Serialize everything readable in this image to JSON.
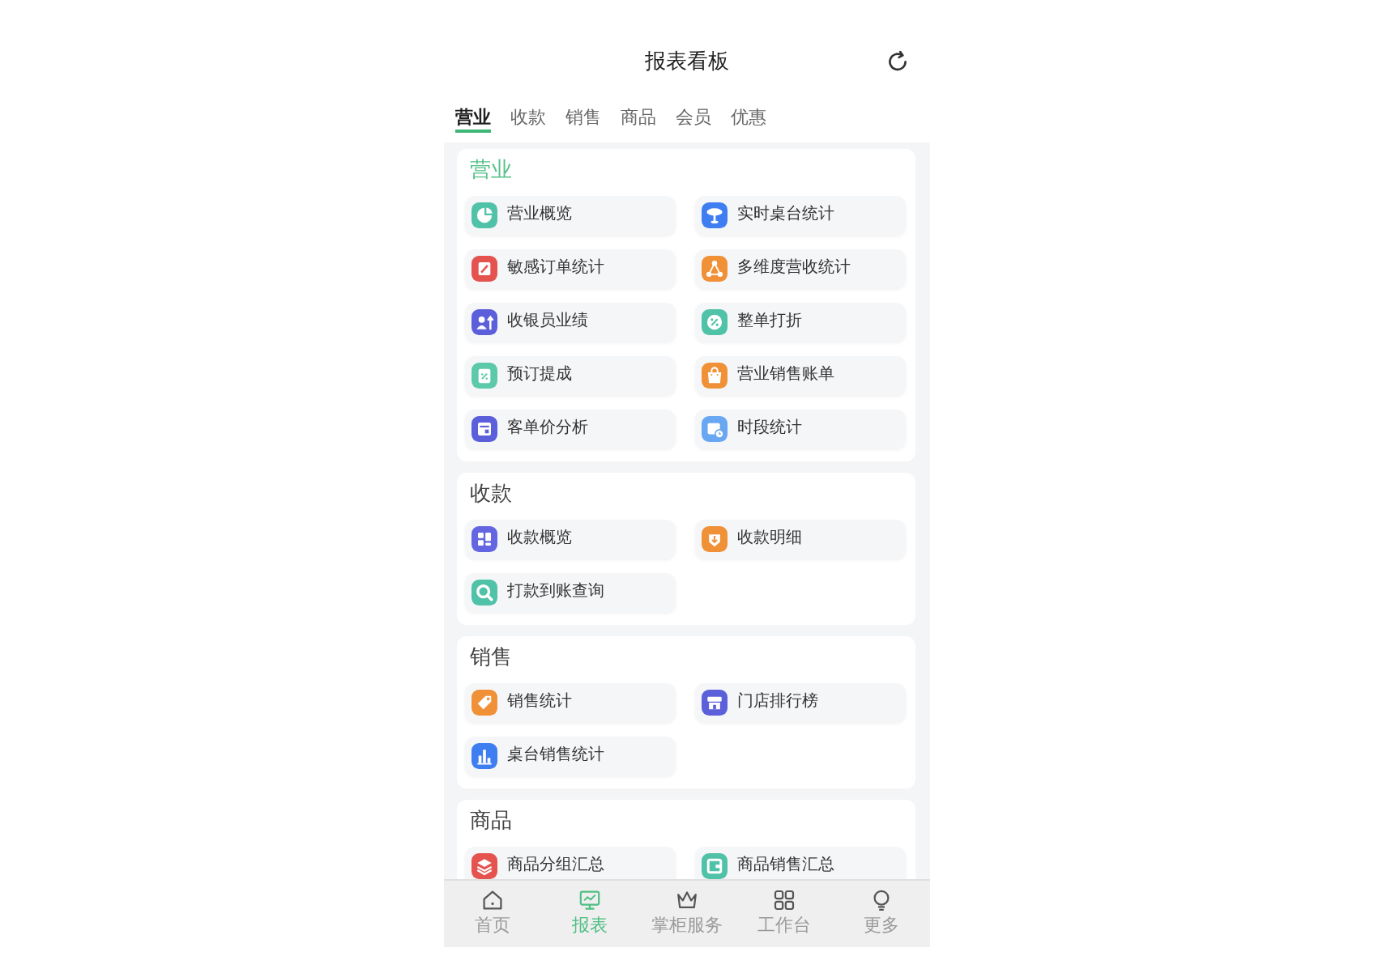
{
  "header": {
    "title": "报表看板"
  },
  "tabs": [
    {
      "label": "营业",
      "selected": true
    },
    {
      "label": "收款",
      "selected": false
    },
    {
      "label": "销售",
      "selected": false
    },
    {
      "label": "商品",
      "selected": false
    },
    {
      "label": "会员",
      "selected": false
    },
    {
      "label": "优惠",
      "selected": false
    }
  ],
  "sections": [
    {
      "title": "营业",
      "active": true,
      "items": [
        {
          "label": "营业概览",
          "color": "#4fc2a8"
        },
        {
          "label": "实时桌台统计",
          "color": "#3f7ef1"
        },
        {
          "label": "敏感订单统计",
          "color": "#e5534f"
        },
        {
          "label": "多维度营收统计",
          "color": "#f09138"
        },
        {
          "label": "收银员业绩",
          "color": "#5b5fd9"
        },
        {
          "label": "整单打折",
          "color": "#4fc2a8"
        },
        {
          "label": "预订提成",
          "color": "#5ccaa9"
        },
        {
          "label": "营业销售账单",
          "color": "#f09138"
        },
        {
          "label": "客单价分析",
          "color": "#5b5fd9"
        },
        {
          "label": "时段统计",
          "color": "#69a7f2"
        }
      ]
    },
    {
      "title": "收款",
      "active": false,
      "items": [
        {
          "label": "收款概览",
          "color": "#6366e0"
        },
        {
          "label": "收款明细",
          "color": "#f09138"
        },
        {
          "label": "打款到账查询",
          "color": "#4fc2a8"
        }
      ]
    },
    {
      "title": "销售",
      "active": false,
      "items": [
        {
          "label": "销售统计",
          "color": "#f09138"
        },
        {
          "label": "门店排行榜",
          "color": "#5b5fd9"
        },
        {
          "label": "桌台销售统计",
          "color": "#3f7ef1"
        }
      ]
    },
    {
      "title": "商品",
      "active": false,
      "items": [
        {
          "label": "商品分组汇总",
          "color": "#e5534f"
        },
        {
          "label": "商品销售汇总",
          "color": "#4fc2a8"
        }
      ]
    }
  ],
  "nav": [
    {
      "label": "首页",
      "selected": false
    },
    {
      "label": "报表",
      "selected": true
    },
    {
      "label": "掌柜服务",
      "selected": false
    },
    {
      "label": "工作台",
      "selected": false
    },
    {
      "label": "更多",
      "selected": false
    }
  ]
}
